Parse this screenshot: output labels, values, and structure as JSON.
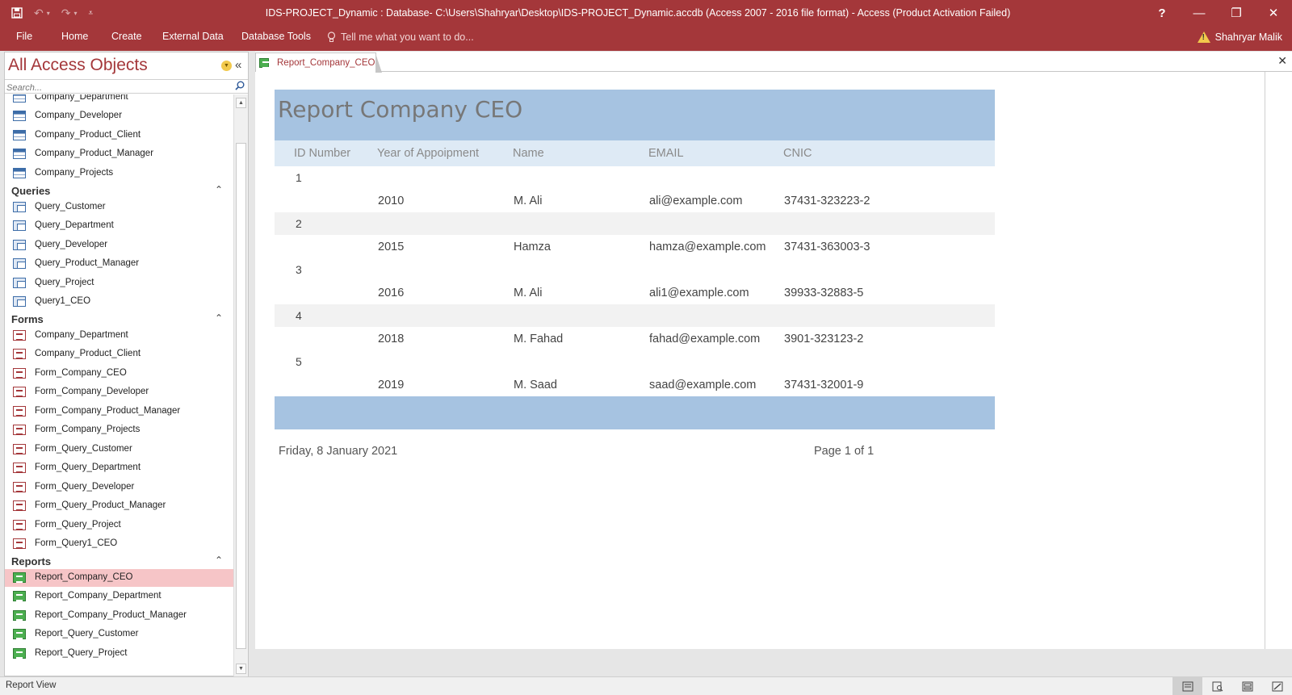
{
  "title_bar": {
    "window_title": "IDS-PROJECT_Dynamic : Database- C:\\Users\\Shahryar\\Desktop\\IDS-PROJECT_Dynamic.accdb (Access 2007 - 2016 file format) - Access (Product Activation Failed)",
    "help": "?",
    "minimize": "—",
    "restore": "❐",
    "close": "✕"
  },
  "ribbon": {
    "tabs": [
      "File",
      "Home",
      "Create",
      "External Data",
      "Database Tools"
    ],
    "tell_me": "Tell me what you want to do...",
    "user": "Shahryar Malik"
  },
  "nav_pane": {
    "title": "All Access Objects",
    "search_placeholder": "Search...",
    "tables": [
      "Company_Department",
      "Company_Developer",
      "Company_Product_Client",
      "Company_Product_Manager",
      "Company_Projects"
    ],
    "sections": {
      "queries": "Queries",
      "forms": "Forms",
      "reports": "Reports"
    },
    "queries": [
      "Query_Customer",
      "Query_Department",
      "Query_Developer",
      "Query_Product_Manager",
      "Query_Project",
      "Query1_CEO"
    ],
    "forms": [
      "Company_Department",
      "Company_Product_Client",
      "Form_Company_CEO",
      "Form_Company_Developer",
      "Form_Company_Product_Manager",
      "Form_Company_Projects",
      "Form_Query_Customer",
      "Form_Query_Department",
      "Form_Query_Developer",
      "Form_Query_Product_Manager",
      "Form_Query_Project",
      "Form_Query1_CEO"
    ],
    "reports": [
      "Report_Company_CEO",
      "Report_Company_Department",
      "Report_Company_Product_Manager",
      "Report_Query_Customer",
      "Report_Query_Project"
    ],
    "selected": "Report_Company_CEO"
  },
  "document": {
    "tab_label": "Report_Company_CEO",
    "close": "✕"
  },
  "report": {
    "title": "Report Company CEO",
    "columns": [
      "ID Number",
      "Year of Appoipment",
      "Name",
      "EMAIL",
      "CNIC"
    ],
    "rows": [
      {
        "id": "1",
        "year": "2010",
        "name": "M. Ali",
        "email": "ali@example.com",
        "cnic": "37431-323223-2"
      },
      {
        "id": "2",
        "year": "2015",
        "name": "Hamza",
        "email": "hamza@example.com",
        "cnic": "37431-363003-3"
      },
      {
        "id": "3",
        "year": "2016",
        "name": "M. Ali",
        "email": "ali1@example.com",
        "cnic": "39933-32883-5"
      },
      {
        "id": "4",
        "year": "2018",
        "name": "M. Fahad",
        "email": "fahad@example.com",
        "cnic": "3901-323123-2"
      },
      {
        "id": "5",
        "year": "2019",
        "name": "M. Saad",
        "email": "saad@example.com",
        "cnic": "37431-32001-9"
      }
    ],
    "footer_date": "Friday, 8 January 2021",
    "footer_page": "Page 1 of 1"
  },
  "status_bar": {
    "text": "Report View"
  },
  "colors": {
    "accent": "#a4373a",
    "report_header": "#a6c3e1",
    "column_header": "#deeaf5",
    "selected_item": "#f6c5c7"
  }
}
